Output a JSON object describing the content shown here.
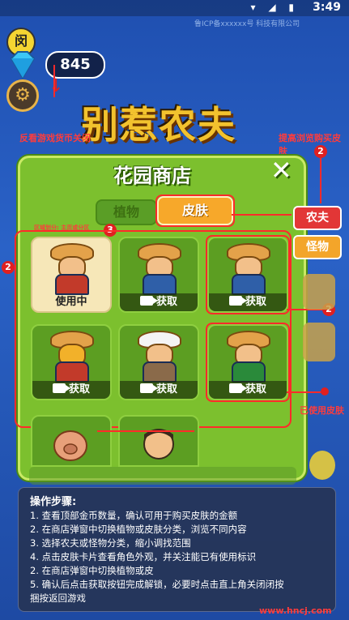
{
  "status": {
    "time": "3:49",
    "icons": "▾ ◢ ▮"
  },
  "topbar_text": "鲁ICP备xxxxxx号 科技有限公司",
  "app_icon_label": "闵",
  "coins": "845",
  "game_title": "别惹农夫",
  "annotations": {
    "left_top": "反看游戏货币关闭",
    "right_top": "提高浏览购买皮肤",
    "filter_note": "区域划分: 主页或分区",
    "used_skin": "已使用皮肤"
  },
  "badges": {
    "b1": "2",
    "b2": "2",
    "b3": "3",
    "b4": "2"
  },
  "shop": {
    "title": "花园商店",
    "close": "✕",
    "tabs": {
      "plant": "植物",
      "skin": "皮肤"
    },
    "side": {
      "farmer": "农夫",
      "monster": "怪物"
    },
    "cards": [
      {
        "label": "使用中",
        "inuse": true
      },
      {
        "label": "获取"
      },
      {
        "label": "获取"
      },
      {
        "label": "获取"
      },
      {
        "label": "获取"
      },
      {
        "label": "获取"
      }
    ]
  },
  "footer": {
    "title": "操作步骤:",
    "lines": [
      "1. 查看顶部金币数量，确认可用于购买皮肤的金额",
      "2. 在商店弹窗中切换植物或皮肤分类，浏览不同内容",
      "3. 选择农夫或怪物分类，缩小调找范围",
      "4. 点击皮肤卡片查看角色外观，并关注能已有使用标识",
      "2. 在商店弹窗中切换植物或皮",
      "5. 确认后点击获取按钮完成解锁，必要时点击直上角关闭闭按",
      "捆按返回游戏"
    ]
  },
  "watermark": "www.hncj.com",
  "colors": {
    "panel": "#7cc02e",
    "accent_orange": "#f7a82a",
    "annotation_red": "#ff2a2a"
  }
}
